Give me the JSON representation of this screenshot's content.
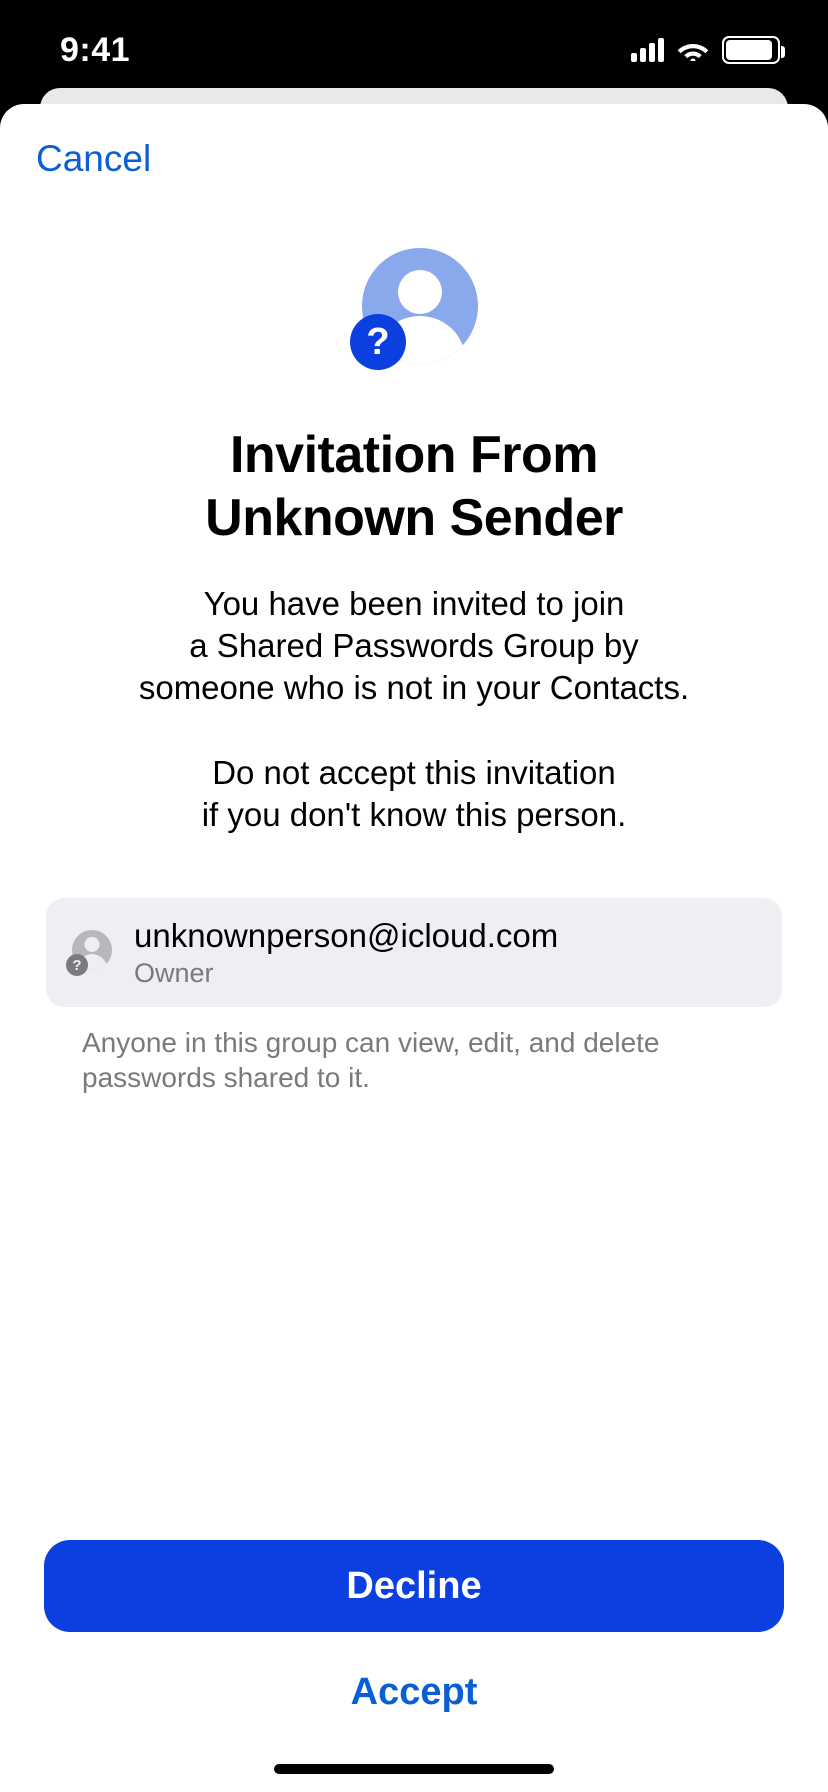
{
  "status": {
    "time": "9:41"
  },
  "sheet": {
    "cancel": "Cancel",
    "title_line1": "Invitation From",
    "title_line2": "Unknown Sender",
    "desc_p1_l1": "You have been invited to join",
    "desc_p1_l2": "a Shared Passwords Group by",
    "desc_p1_l3": "someone who is not in your Contacts.",
    "desc_p2_l1": "Do not accept this invitation",
    "desc_p2_l2": "if you don't know this person."
  },
  "sender": {
    "email": "unknownperson@icloud.com",
    "role": "Owner"
  },
  "footer_note": "Anyone in this group can view, edit, and delete passwords shared to it.",
  "actions": {
    "decline": "Decline",
    "accept": "Accept"
  }
}
